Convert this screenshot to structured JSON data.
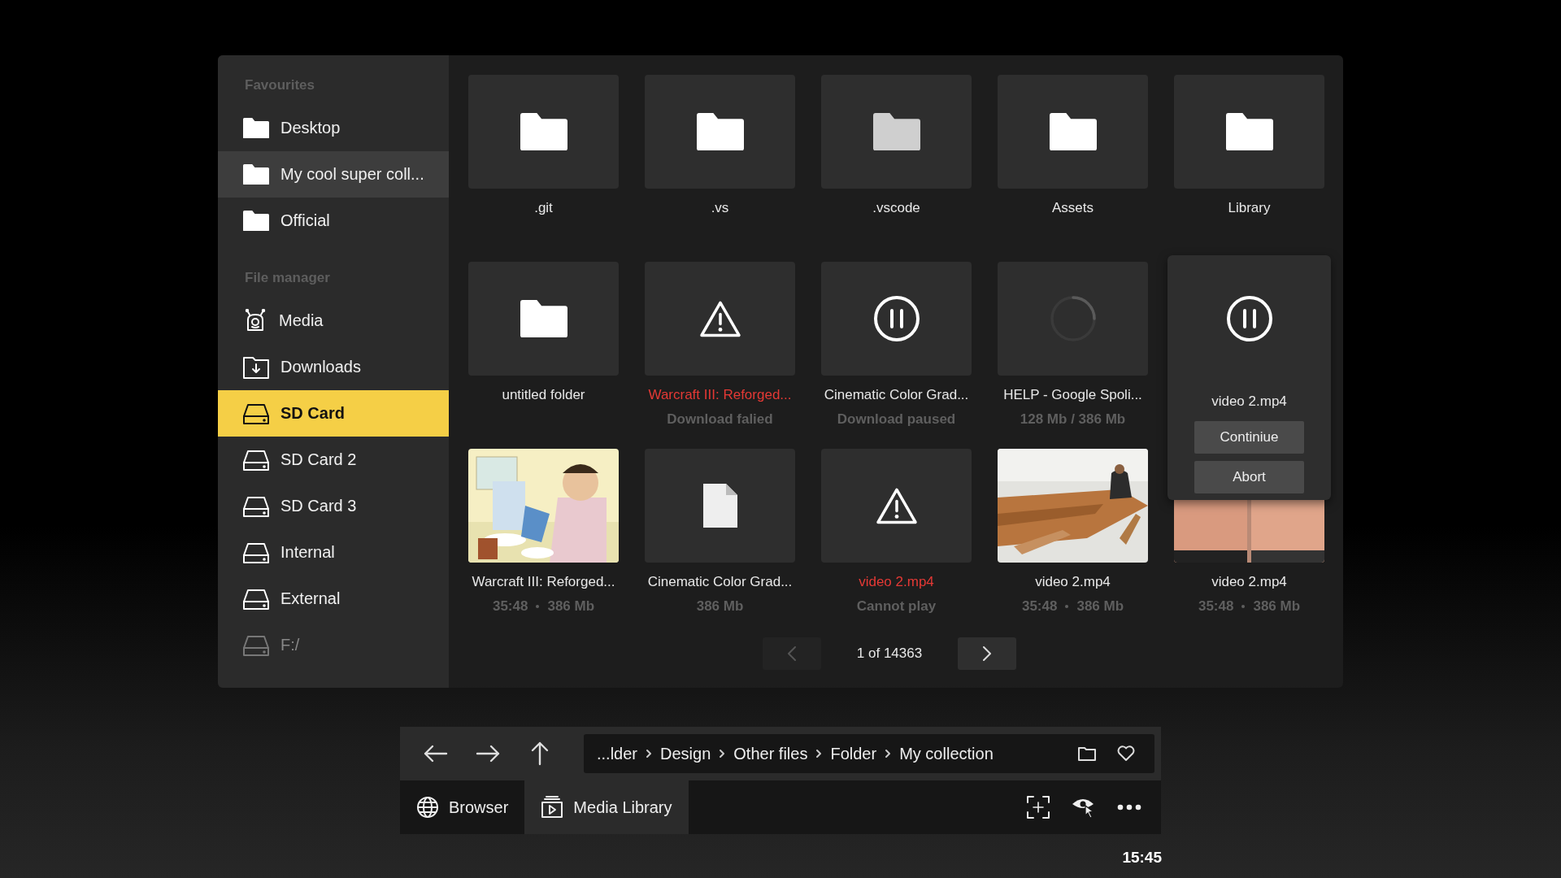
{
  "sidebar": {
    "sections": [
      {
        "title": "Favourites",
        "items": [
          {
            "label": "Desktop",
            "kind": "folder",
            "selected": false,
            "hovered": false,
            "disabled": false
          },
          {
            "label": "My cool super coll...",
            "kind": "folder",
            "selected": false,
            "hovered": true,
            "disabled": false
          },
          {
            "label": "Official",
            "kind": "folder",
            "selected": false,
            "hovered": false,
            "disabled": false
          }
        ]
      },
      {
        "title": "File manager",
        "items": [
          {
            "label": "Media",
            "kind": "media",
            "selected": false,
            "hovered": false,
            "disabled": false
          },
          {
            "label": "Downloads",
            "kind": "downloads",
            "selected": false,
            "hovered": false,
            "disabled": false
          },
          {
            "label": "SD Card",
            "kind": "drive",
            "selected": true,
            "hovered": false,
            "disabled": false
          },
          {
            "label": "SD Card 2",
            "kind": "drive",
            "selected": false,
            "hovered": false,
            "disabled": false
          },
          {
            "label": "SD Card 3",
            "kind": "drive",
            "selected": false,
            "hovered": false,
            "disabled": false
          },
          {
            "label": "Internal",
            "kind": "drive",
            "selected": false,
            "hovered": false,
            "disabled": false
          },
          {
            "label": "External",
            "kind": "drive",
            "selected": false,
            "hovered": false,
            "disabled": false
          },
          {
            "label": "F:/",
            "kind": "drive",
            "selected": false,
            "hovered": false,
            "disabled": true
          }
        ]
      }
    ]
  },
  "files": [
    {
      "kind": "folder",
      "name": ".git",
      "error": false,
      "dimmed": false
    },
    {
      "kind": "folder",
      "name": ".vs",
      "error": false,
      "dimmed": false
    },
    {
      "kind": "folder",
      "name": ".vscode",
      "error": false,
      "dimmed": true
    },
    {
      "kind": "folder",
      "name": "Assets",
      "error": false,
      "dimmed": false
    },
    {
      "kind": "folder",
      "name": "Library",
      "error": false,
      "dimmed": false
    },
    {
      "kind": "folder",
      "name": "untitled folder",
      "error": false,
      "dimmed": false
    },
    {
      "kind": "warning",
      "name": "Warcraft III: Reforged...",
      "error": true,
      "status": "Download falied"
    },
    {
      "kind": "paused",
      "name": "Cinematic Color Grad...",
      "error": false,
      "status": "Download paused"
    },
    {
      "kind": "loading",
      "name": "HELP - Google Spoli...",
      "error": false,
      "status": "128 Mb / 386 Mb"
    },
    {
      "kind": "paused",
      "name": "video 2.mp4",
      "error": false,
      "expanded": true,
      "actions": [
        "Continiue",
        "Abort"
      ]
    },
    {
      "kind": "picture",
      "name": "Warcraft III: Reforged...",
      "error": false,
      "details": [
        "35:48",
        "386 Mb"
      ]
    },
    {
      "kind": "document",
      "name": "Cinematic Color Grad...",
      "error": false,
      "details": [
        "386 Mb"
      ]
    },
    {
      "kind": "warning",
      "name": "video 2.mp4",
      "error": true,
      "status": "Cannot play"
    },
    {
      "kind": "picture",
      "name": "video 2.mp4",
      "error": false,
      "details": [
        "35:48",
        "386 Mb"
      ]
    },
    {
      "kind": "picture",
      "name": "video 2.mp4",
      "error": false,
      "details": [
        "35:48",
        "386 Mb"
      ]
    }
  ],
  "pagination": {
    "label": "1 of 14363",
    "prev_disabled": true,
    "next_disabled": false
  },
  "toolbar": {
    "breadcrumb": [
      "...lder",
      "Design",
      "Other files",
      "Folder",
      "My collection"
    ]
  },
  "tabs": [
    {
      "label": "Browser",
      "selected": false
    },
    {
      "label": "Media Library",
      "selected": true
    }
  ],
  "clock": "15:45"
}
